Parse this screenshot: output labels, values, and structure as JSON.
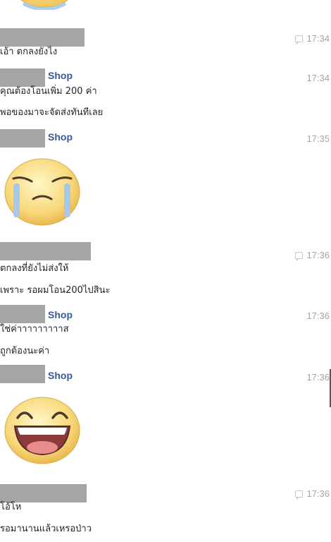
{
  "messages": [
    {
      "kind": "customer",
      "time": "17:34",
      "texts": [
        "เอ้า ตกลงยังไง"
      ]
    },
    {
      "kind": "shop",
      "sender_suffix": "Shop",
      "time": "17:34",
      "texts": [
        "คุณต้องโอนเพิ่ม 200 ค่า",
        "พอของมาจะจัดส่งทันทีเลย"
      ]
    },
    {
      "kind": "shop",
      "sender_suffix": "Shop",
      "time": "17:35",
      "sticker": "crying-face-sticker"
    },
    {
      "kind": "customer",
      "time": "17:36",
      "texts": [
        "ตกลงที่ยังไม่ส่งให้",
        "เพราะ รอผมโอน200ไปสินะ"
      ]
    },
    {
      "kind": "shop",
      "sender_suffix": "Shop",
      "time": "17:36",
      "texts": [
        "ใช่ค่าาาาาาาาาส",
        "ถูกต้องนะค่า"
      ]
    },
    {
      "kind": "shop",
      "sender_suffix": "Shop",
      "time": "17:36",
      "sticker": "laughing-face-sticker"
    },
    {
      "kind": "customer",
      "time": "17:36",
      "texts": [
        "โอ้โห",
        "รอมานานแล้วเหรอป่าว"
      ]
    }
  ],
  "colors": {
    "shop_name": "#3b5998",
    "timestamp": "#a0a5ad",
    "redacted_name": "#a5a5a5",
    "face": "#f8d97a"
  }
}
